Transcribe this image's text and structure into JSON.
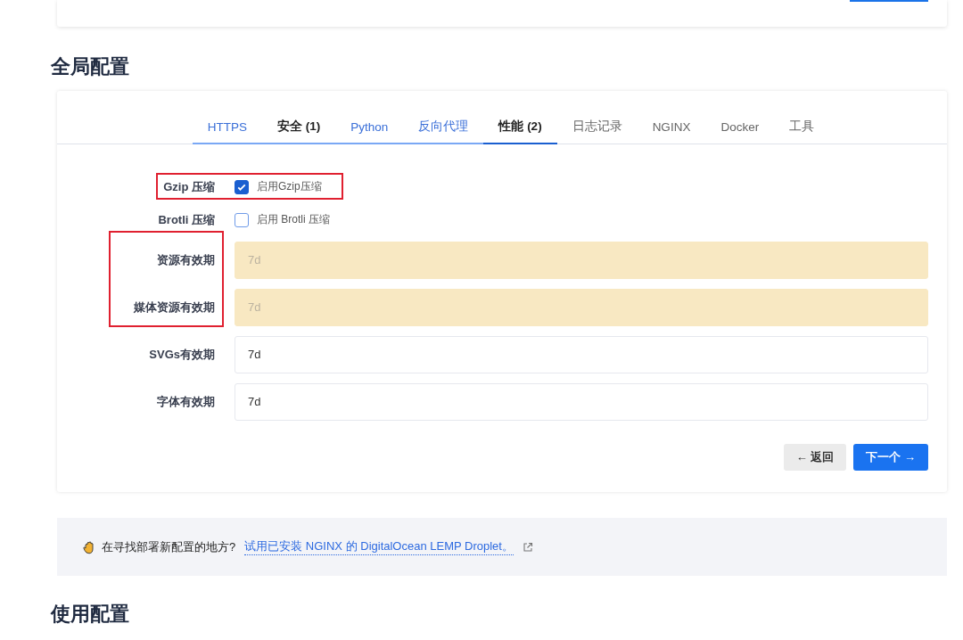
{
  "top_card": {
    "button_partial": true
  },
  "global_config": {
    "heading": "全局配置",
    "tabs": [
      {
        "label": "HTTPS",
        "selected": false,
        "visited": true,
        "flagged": false
      },
      {
        "label": "安全 (1)",
        "selected": false,
        "visited": true,
        "flagged": true
      },
      {
        "label": "Python",
        "selected": false,
        "visited": true,
        "flagged": false
      },
      {
        "label": "反向代理",
        "selected": false,
        "visited": true,
        "flagged": false
      },
      {
        "label": "性能 (2)",
        "selected": true,
        "visited": true,
        "flagged": true
      },
      {
        "label": "日志记录",
        "selected": false,
        "visited": false,
        "flagged": false
      },
      {
        "label": "NGINX",
        "selected": false,
        "visited": false,
        "flagged": false
      },
      {
        "label": "Docker",
        "selected": false,
        "visited": false,
        "flagged": false
      },
      {
        "label": "工具",
        "selected": false,
        "visited": false,
        "flagged": false
      }
    ],
    "rows": [
      {
        "kind": "checkbox",
        "label": "Gzip 压缩",
        "text": "启用Gzip压缩",
        "checked": true,
        "annotated": true
      },
      {
        "kind": "checkbox",
        "label": "Brotli 压缩",
        "text": "启用 Brotli 压缩",
        "checked": false,
        "annotated": false
      },
      {
        "kind": "field",
        "label": "资源有效期",
        "placeholder": "7d",
        "warning": true,
        "annotated": true
      },
      {
        "kind": "field",
        "label": "媒体资源有效期",
        "placeholder": "7d",
        "warning": true,
        "annotated": true
      },
      {
        "kind": "field",
        "label": "SVGs有效期",
        "value": "7d",
        "warning": false,
        "annotated": false
      },
      {
        "kind": "field",
        "label": "字体有效期",
        "value": "7d",
        "warning": false,
        "annotated": false
      }
    ],
    "back_button": "← 返回",
    "next_button": "下一个 →"
  },
  "notice": {
    "question": "在寻找部署新配置的地方?",
    "link": "试用已安装 NGINX 的 DigitalOcean LEMP Droplet。"
  },
  "usage_heading": "使用配置"
}
